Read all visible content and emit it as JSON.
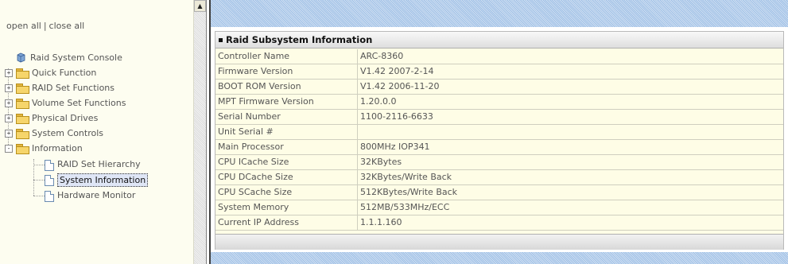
{
  "nav": {
    "open_all": "open all",
    "separator": "|",
    "close_all": "close all",
    "root": "Raid System Console",
    "items": [
      {
        "label": "Quick Function",
        "expander": "+"
      },
      {
        "label": "RAID Set Functions",
        "expander": "+"
      },
      {
        "label": "Volume Set Functions",
        "expander": "+"
      },
      {
        "label": "Physical Drives",
        "expander": "+"
      },
      {
        "label": "System Controls",
        "expander": "+"
      },
      {
        "label": "Information",
        "expander": "-"
      }
    ],
    "sub_items": [
      {
        "label": "RAID Set Hierarchy"
      },
      {
        "label": "System Information",
        "selected": true
      },
      {
        "label": "Hardware Monitor"
      }
    ]
  },
  "panel": {
    "title": "Raid Subsystem Information",
    "rows": [
      {
        "key": "Controller Name",
        "value": "ARC-8360"
      },
      {
        "key": "Firmware Version",
        "value": "V1.42 2007-2-14"
      },
      {
        "key": "BOOT ROM Version",
        "value": "V1.42 2006-11-20"
      },
      {
        "key": "MPT Firmware Version",
        "value": "1.20.0.0"
      },
      {
        "key": "Serial Number",
        "value": "1100-2116-6633"
      },
      {
        "key": "Unit Serial #",
        "value": ""
      },
      {
        "key": "Main Processor",
        "value": "800MHz IOP341"
      },
      {
        "key": "CPU ICache Size",
        "value": "32KBytes"
      },
      {
        "key": "CPU DCache Size",
        "value": "32KBytes/Write Back"
      },
      {
        "key": "CPU SCache Size",
        "value": "512KBytes/Write Back"
      },
      {
        "key": "System Memory",
        "value": "512MB/533MHz/ECC"
      },
      {
        "key": "Current IP Address",
        "value": "1.1.1.160"
      }
    ]
  },
  "colors": {
    "nav_bg": "#fdfdf0",
    "panel_bg": "#fefde6",
    "header_pattern": "#9fc0e6",
    "folder": "#f6d56b",
    "selection": "#dfe6f6"
  },
  "icons": {
    "root": "raid-console-icon",
    "folder": "folder-icon",
    "page": "page-icon",
    "expand": "plus-box-icon",
    "collapse": "minus-box-icon",
    "scroll_up": "scroll-up-arrow-icon"
  }
}
